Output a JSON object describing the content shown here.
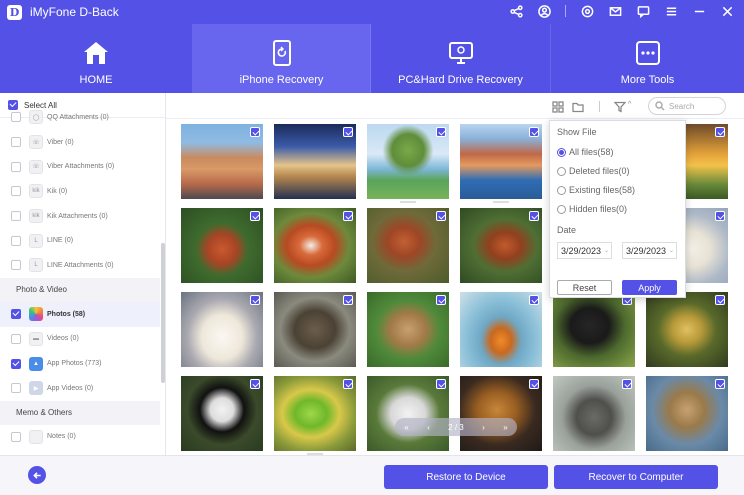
{
  "app": {
    "title": "iMyFone D-Back",
    "logo_letter": "D"
  },
  "nav": {
    "tabs": [
      {
        "label": "HOME",
        "icon": "home-icon"
      },
      {
        "label": "iPhone Recovery",
        "icon": "phone-refresh-icon"
      },
      {
        "label": "PC&Hard Drive Recovery",
        "icon": "monitor-icon"
      },
      {
        "label": "More Tools",
        "icon": "more-dots-icon"
      }
    ],
    "active_tab": 1
  },
  "sidebar": {
    "select_all": "Select All",
    "items": [
      {
        "label": "QQ Attachments (0)",
        "icon_glyph": "",
        "checked": false
      },
      {
        "label": "Viber (0)",
        "icon_glyph": "☏",
        "checked": false
      },
      {
        "label": "Viber Attachments (0)",
        "icon_glyph": "☏",
        "checked": false
      },
      {
        "label": "Kik (0)",
        "icon_glyph": "kik",
        "checked": false
      },
      {
        "label": "Kik Attachments (0)",
        "icon_glyph": "kik",
        "checked": false
      },
      {
        "label": "LINE (0)",
        "icon_glyph": "L",
        "checked": false
      },
      {
        "label": "LINE Attachments (0)",
        "icon_glyph": "L",
        "checked": false
      }
    ],
    "section_photo": "Photo & Video",
    "photo_items": [
      {
        "label": "Photos (58)",
        "checked": true,
        "selected": true
      },
      {
        "label": "Videos (0)",
        "checked": false,
        "selected": false
      },
      {
        "label": "App Photos (773)",
        "checked": true,
        "selected": false
      },
      {
        "label": "App Videos (0)",
        "checked": false,
        "selected": false
      }
    ],
    "section_memo": "Memo & Others",
    "memo_items": [
      {
        "label": "Notes (0)",
        "checked": false
      }
    ]
  },
  "toolbar": {
    "search_placeholder": "Search"
  },
  "filter": {
    "show_file_title": "Show File",
    "options": [
      {
        "label": "All files(58)",
        "selected": true
      },
      {
        "label": "Deleted files(0)",
        "selected": false
      },
      {
        "label": "Existing files(58)",
        "selected": false
      },
      {
        "label": "Hidden files(0)",
        "selected": false
      }
    ],
    "date_title": "Date",
    "date_from": "3/29/2023",
    "date_to": "3/29/2023",
    "reset_label": "Reset",
    "apply_label": "Apply"
  },
  "pager": {
    "text": "2 / 3"
  },
  "footer": {
    "restore_label": "Restore to Device",
    "recover_label": "Recover to Computer"
  },
  "colors": {
    "accent": "#5452e6"
  }
}
